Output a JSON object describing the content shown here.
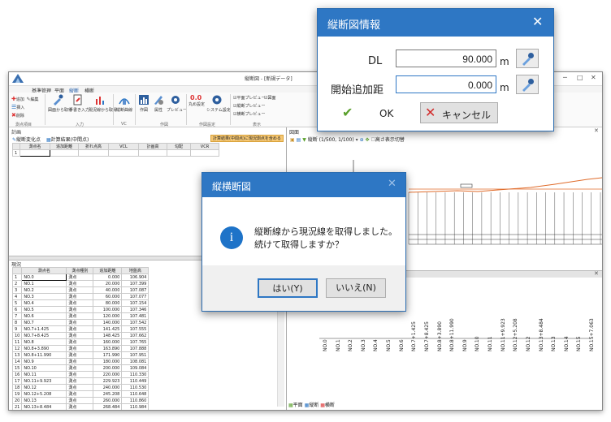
{
  "main_window": {
    "title": "縦断図 - [新規データ]",
    "ribbon_tabs": [
      "基準管理",
      "平面",
      "縦断",
      "横断"
    ],
    "ribbon": {
      "small_buttons": [
        "追加",
        "編集",
        "挿入",
        "削除"
      ],
      "group_basic": "測点項目",
      "buttons_input": [
        "図面から取得",
        "手書き入力",
        "現況線から取得"
      ],
      "group_input": "入力",
      "button_vc": "縦断曲線",
      "group_vc": "VC",
      "buttons_draw": [
        "作図",
        "属性",
        "プレビュー"
      ],
      "group_draw": "作図",
      "buttons_settings": [
        "丸め設定",
        "システム設定"
      ],
      "group_settings": "作図設定",
      "checkboxes": [
        "平面プレビュー",
        "縦断プレビュー",
        "横断プレビュー",
        "図面"
      ],
      "group_display": "表示"
    }
  },
  "plan_panel": {
    "header": "計画",
    "tabs": [
      "縦断変化点",
      "計算結果(中間点)"
    ],
    "warning": "計算結果(中間点)に現況測点を含める",
    "columns": [
      "測点名",
      "追加距離",
      "折れ点高",
      "VCL",
      "計画高",
      "勾配",
      "VCR"
    ],
    "rows": [
      [
        "1",
        "",
        "",
        "",
        "",
        "",
        "",
        ""
      ]
    ]
  },
  "current_panel": {
    "header": "現況",
    "columns": [
      "",
      "測点名",
      "測点種別",
      "追加距離",
      "地盤高"
    ],
    "rows": [
      [
        "1",
        "NO.0",
        "測点",
        "0.000",
        "106.904"
      ],
      [
        "2",
        "NO.1",
        "測点",
        "20.000",
        "107.399"
      ],
      [
        "3",
        "NO.2",
        "測点",
        "40.000",
        "107.087"
      ],
      [
        "4",
        "NO.3",
        "測点",
        "60.000",
        "107.077"
      ],
      [
        "5",
        "NO.4",
        "測点",
        "80.000",
        "107.154"
      ],
      [
        "6",
        "NO.5",
        "測点",
        "100.000",
        "107.346"
      ],
      [
        "7",
        "NO.6",
        "測点",
        "120.000",
        "107.481"
      ],
      [
        "8",
        "NO.7",
        "測点",
        "140.000",
        "107.542"
      ],
      [
        "9",
        "NO.7+1.425",
        "測点",
        "141.425",
        "107.555"
      ],
      [
        "10",
        "NO.7+8.425",
        "測点",
        "148.425",
        "107.662"
      ],
      [
        "11",
        "NO.8",
        "測点",
        "160.000",
        "107.765"
      ],
      [
        "12",
        "NO.8+3.890",
        "測点",
        "163.890",
        "107.888"
      ],
      [
        "13",
        "NO.8+11.990",
        "測点",
        "171.990",
        "107.951"
      ],
      [
        "14",
        "NO.9",
        "測点",
        "180.000",
        "108.081"
      ],
      [
        "15",
        "NO.10",
        "測点",
        "200.000",
        "109.084"
      ],
      [
        "16",
        "NO.11",
        "測点",
        "220.000",
        "110.330"
      ],
      [
        "17",
        "NO.11+9.923",
        "測点",
        "229.923",
        "110.449"
      ],
      [
        "18",
        "NO.12",
        "測点",
        "240.000",
        "110.530"
      ],
      [
        "19",
        "NO.12+5.208",
        "測点",
        "245.208",
        "110.648"
      ],
      [
        "20",
        "NO.13",
        "測点",
        "260.000",
        "110.860"
      ],
      [
        "21",
        "NO.13+8.484",
        "測点",
        "268.484",
        "110.984"
      ]
    ]
  },
  "drawing_panel": {
    "header": "図面",
    "toolbar_scale": "縦断 (1/500, 1/100)",
    "toolbar_toggle": "高さ表示切替",
    "station_labels": [
      "NO.0",
      "NO.1",
      "NO.2",
      "NO.3",
      "NO.4",
      "NO.5",
      "NO.6",
      "NO.7+1.425",
      "NO.7+8.425",
      "NO.8+3.890",
      "NO.8+11.990",
      "NO.9",
      "NO.10",
      "NO.11",
      "NO.11+9.923",
      "NO.12+5.208",
      "NO.12",
      "NO.13+8.484",
      "NO.13",
      "NO.14",
      "NO.15",
      "NO.15+7.063"
    ],
    "bottom_tabs": [
      "平面",
      "縦断",
      "横断"
    ]
  },
  "dialog_info": {
    "title": "縦断図情報",
    "dl_label": "DL",
    "dl_value": "90.000",
    "start_label": "開始追加距",
    "start_value": "0.000",
    "unit": "m",
    "ok_label": "OK",
    "cancel_label": "キャンセル"
  },
  "dialog_confirm": {
    "title": "縦横断図",
    "message_line1": "縦断線から現況線を取得しました。",
    "message_line2": "続けて取得しますか？",
    "yes_label": "はい(Y)",
    "no_label": "いいえ(N)",
    "info_icon_char": "i"
  },
  "colors": {
    "dialog_title_bar": "#2e77c4",
    "ok_check": "#5aa02c",
    "cancel_x": "#d22b2b",
    "info_icon": "#1e73c8",
    "profile_line": "#e06b2a"
  }
}
